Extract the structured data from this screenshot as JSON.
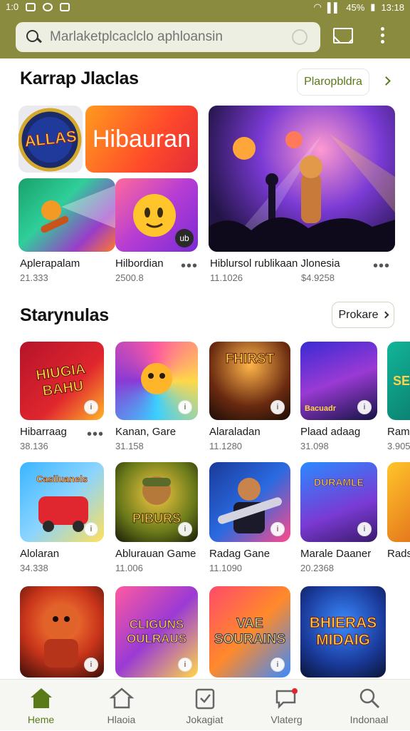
{
  "status": {
    "time": "1:0",
    "battery": "45%",
    "clock": "13:18"
  },
  "search": {
    "placeholder": "Marlaketplcaclclo aphloansin"
  },
  "section1": {
    "title": "Karrap Jlaclas",
    "link": "Plaropbldra",
    "items": [
      {
        "name": "Aplerapalam",
        "meta": "21.333"
      },
      {
        "name": "Hilbordian",
        "meta": "2500.8"
      },
      {
        "name": "Hiblursol rublikaan Jlonesia",
        "meta": "11.1026"
      },
      {
        "meta": "$4.9258"
      }
    ],
    "tiles": {
      "alias": "ALLAS",
      "hiburan": "Hibauran",
      "ub": "ub"
    }
  },
  "section2": {
    "title": "Starynulas",
    "link": "Prokare",
    "rows": [
      [
        {
          "name": "Hibarraag",
          "meta": "38.136",
          "art": "HIUGIA BAHU"
        },
        {
          "name": "Kanan, Gare",
          "meta": "31.158",
          "art": ""
        },
        {
          "name": "Alaraladan",
          "meta": "11.1280",
          "art": "FHIRST"
        },
        {
          "name": "Plaad adaag",
          "meta": "31.098",
          "art": "Bacuadr"
        },
        {
          "name": "Ramu",
          "meta": "3.905",
          "art": "SE"
        }
      ],
      [
        {
          "name": "Alolaran",
          "meta": "34.338",
          "art": "Casiluanels"
        },
        {
          "name": "Ablurauan Game",
          "meta": "11.006",
          "art": "PIBURS"
        },
        {
          "name": "Radag Gane",
          "meta": "11.1090",
          "art": ""
        },
        {
          "name": "Marale Daaner",
          "meta": "20.2368",
          "art": "DURAMLE"
        },
        {
          "name": "Rads",
          "meta": "",
          "art": ""
        }
      ],
      [
        {
          "art": ""
        },
        {
          "art": "CLIGUNS OULRAUS"
        },
        {
          "art": "VAE SOURAINS"
        },
        {
          "art": "BHIERAS MIDAIG"
        }
      ]
    ]
  },
  "nav": [
    {
      "label": "Heme"
    },
    {
      "label": "Hlaoia"
    },
    {
      "label": "Jokagiat"
    },
    {
      "label": "Vlaterg"
    },
    {
      "label": "Indonaal"
    }
  ],
  "colors": {
    "accent": "#8a8b3e",
    "link": "#5a7a1a"
  }
}
